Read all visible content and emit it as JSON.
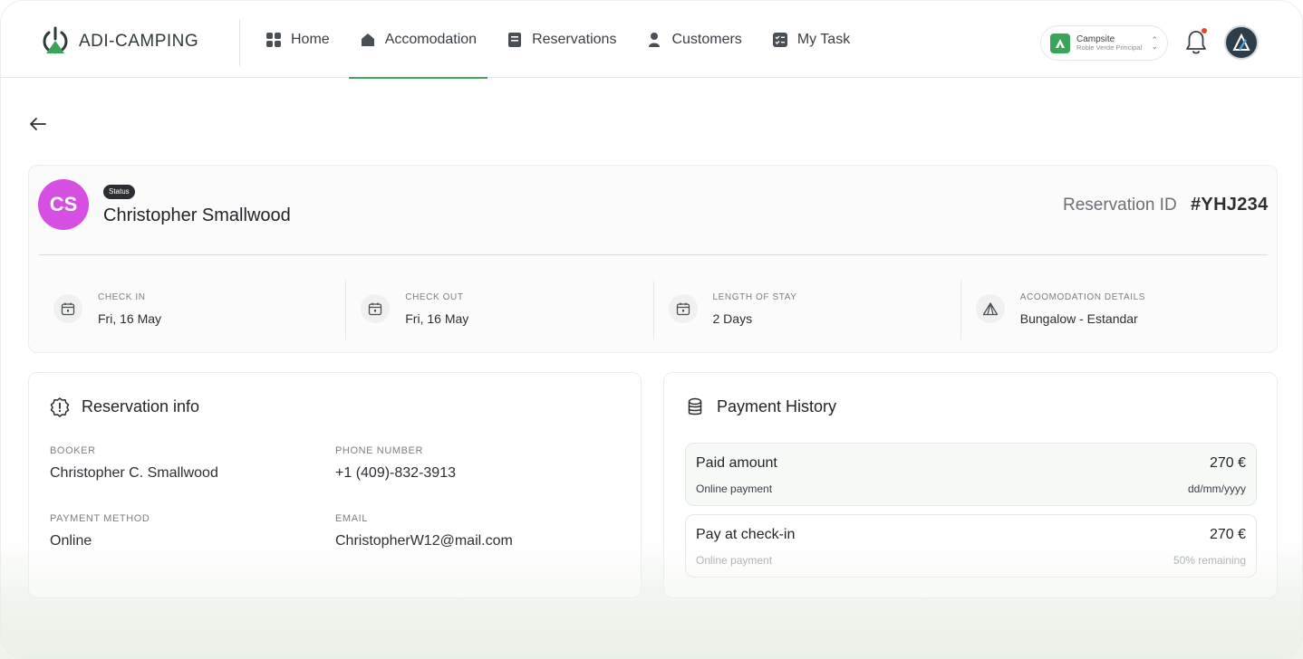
{
  "header": {
    "brand": "ADI-CAMPING",
    "nav": [
      {
        "label": "Home",
        "icon": "grid-icon"
      },
      {
        "label": "Accomodation",
        "icon": "house-icon"
      },
      {
        "label": "Reservations",
        "icon": "reservations-icon"
      },
      {
        "label": "Customers",
        "icon": "person-icon"
      },
      {
        "label": "My Task",
        "icon": "task-icon"
      }
    ],
    "active_nav": "Accomodation",
    "campsite": {
      "title": "Campsite",
      "subtitle": "Roble Verde Principal"
    }
  },
  "guest": {
    "initials": "CS",
    "status": "Status",
    "name": "Christopher Smallwood",
    "reservation_id_label": "Reservation ID",
    "reservation_id": "#YHJ234"
  },
  "stats": [
    {
      "label": "CHECK IN",
      "value": "Fri, 16 May",
      "icon": "calendar-icon"
    },
    {
      "label": "CHECK OUT",
      "value": "Fri, 16 May",
      "icon": "calendar-icon"
    },
    {
      "label": "LENGTH OF  STAY",
      "value": "2 Days",
      "icon": "calendar-icon"
    },
    {
      "label": "ACOOMODATION DETAILS",
      "value": "Bungalow - Estandar",
      "icon": "tent-icon"
    }
  ],
  "reservation_info": {
    "title": "Reservation info",
    "booker_label": "BOOKER",
    "booker": "Christopher C. Smallwood",
    "phone_label": "PHONE NUMBER",
    "phone": "+1 (409)-832-3913",
    "payment_method_label": "PAYMENT METHOD",
    "payment_method": "Online",
    "email_label": "EMAIL",
    "email": "ChristopherW12@mail.com"
  },
  "payment_history": {
    "title": "Payment History",
    "rows": [
      {
        "title": "Paid amount",
        "amount": "270 €",
        "sub": "Online payment",
        "right": "dd/mm/yyyy"
      },
      {
        "title": "Pay at check-in",
        "amount": "270 €",
        "sub": "Online payment",
        "right": "50% remaining"
      }
    ]
  },
  "colors": {
    "accent": "#3fa65a",
    "avatar": "#d54fe2",
    "notification": "#e8442e"
  }
}
